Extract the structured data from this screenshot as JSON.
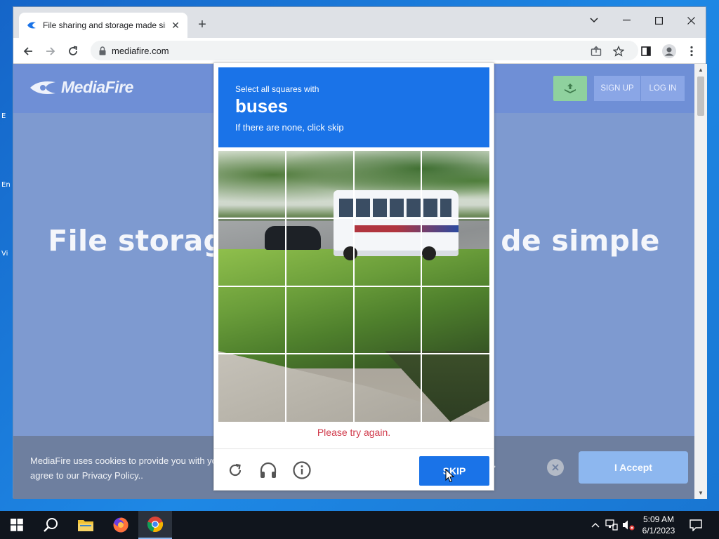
{
  "browser": {
    "tab_title": "File sharing and storage made simple",
    "url": "mediafire.com",
    "icons": {
      "back": "arrow-left-icon",
      "forward": "arrow-right-icon",
      "reload": "reload-icon",
      "lock": "lock-icon",
      "share": "share-icon",
      "bookmark": "star-icon",
      "side_panel": "side-panel-icon",
      "profile": "profile-icon",
      "menu": "kebab-menu-icon"
    }
  },
  "site": {
    "logo_text": "MediaFire",
    "signup_label": "SIGN UP",
    "login_label": "LOG IN",
    "hero_left": "File storag",
    "hero_right": "de simple",
    "cookie_text": "MediaFire uses cookies to provide you with you agree to our Privacy Policy..",
    "cookie_trailing": ",",
    "accept_label": "I Accept"
  },
  "captcha": {
    "instruction": "Select all squares with",
    "target": "buses",
    "subtext": "If there are none, click skip",
    "error": "Please try again.",
    "skip_label": "SKIP",
    "grid_size": 4,
    "accent": "#1a73e8",
    "error_color": "#d0394a"
  },
  "taskbar": {
    "time": "5:09 AM",
    "date": "6/1/2023",
    "apps": [
      "start-icon",
      "search-icon",
      "file-explorer-icon",
      "firefox-icon",
      "chrome-icon"
    ]
  }
}
